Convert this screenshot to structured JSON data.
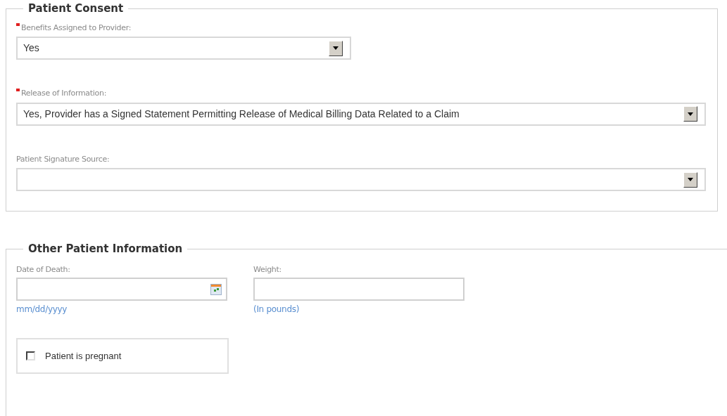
{
  "sections": [
    {
      "title": "Patient Consent",
      "fields": [
        {
          "kind": "select",
          "label": "Benefits Assigned to Provider:",
          "required": true,
          "value": "Yes",
          "wide": false
        },
        {
          "kind": "select",
          "label": "Release of Information:",
          "required": true,
          "value": "Yes, Provider has a Signed Statement Permitting Release of Medical Billing Data Related to a Claim",
          "wide": true
        },
        {
          "kind": "select",
          "label": "Patient Signature Source:",
          "required": false,
          "wide": true
        }
      ]
    },
    {
      "title": "Other Patient Information",
      "inputs": [
        {
          "kind": "date",
          "label": "Date of Death:",
          "hint": "mm/dd/yyyy"
        },
        {
          "kind": "text",
          "label": "Weight:",
          "hint": "(In pounds)"
        }
      ],
      "checkbox": {
        "label": "Patient is pregnant",
        "checked": false
      }
    }
  ]
}
